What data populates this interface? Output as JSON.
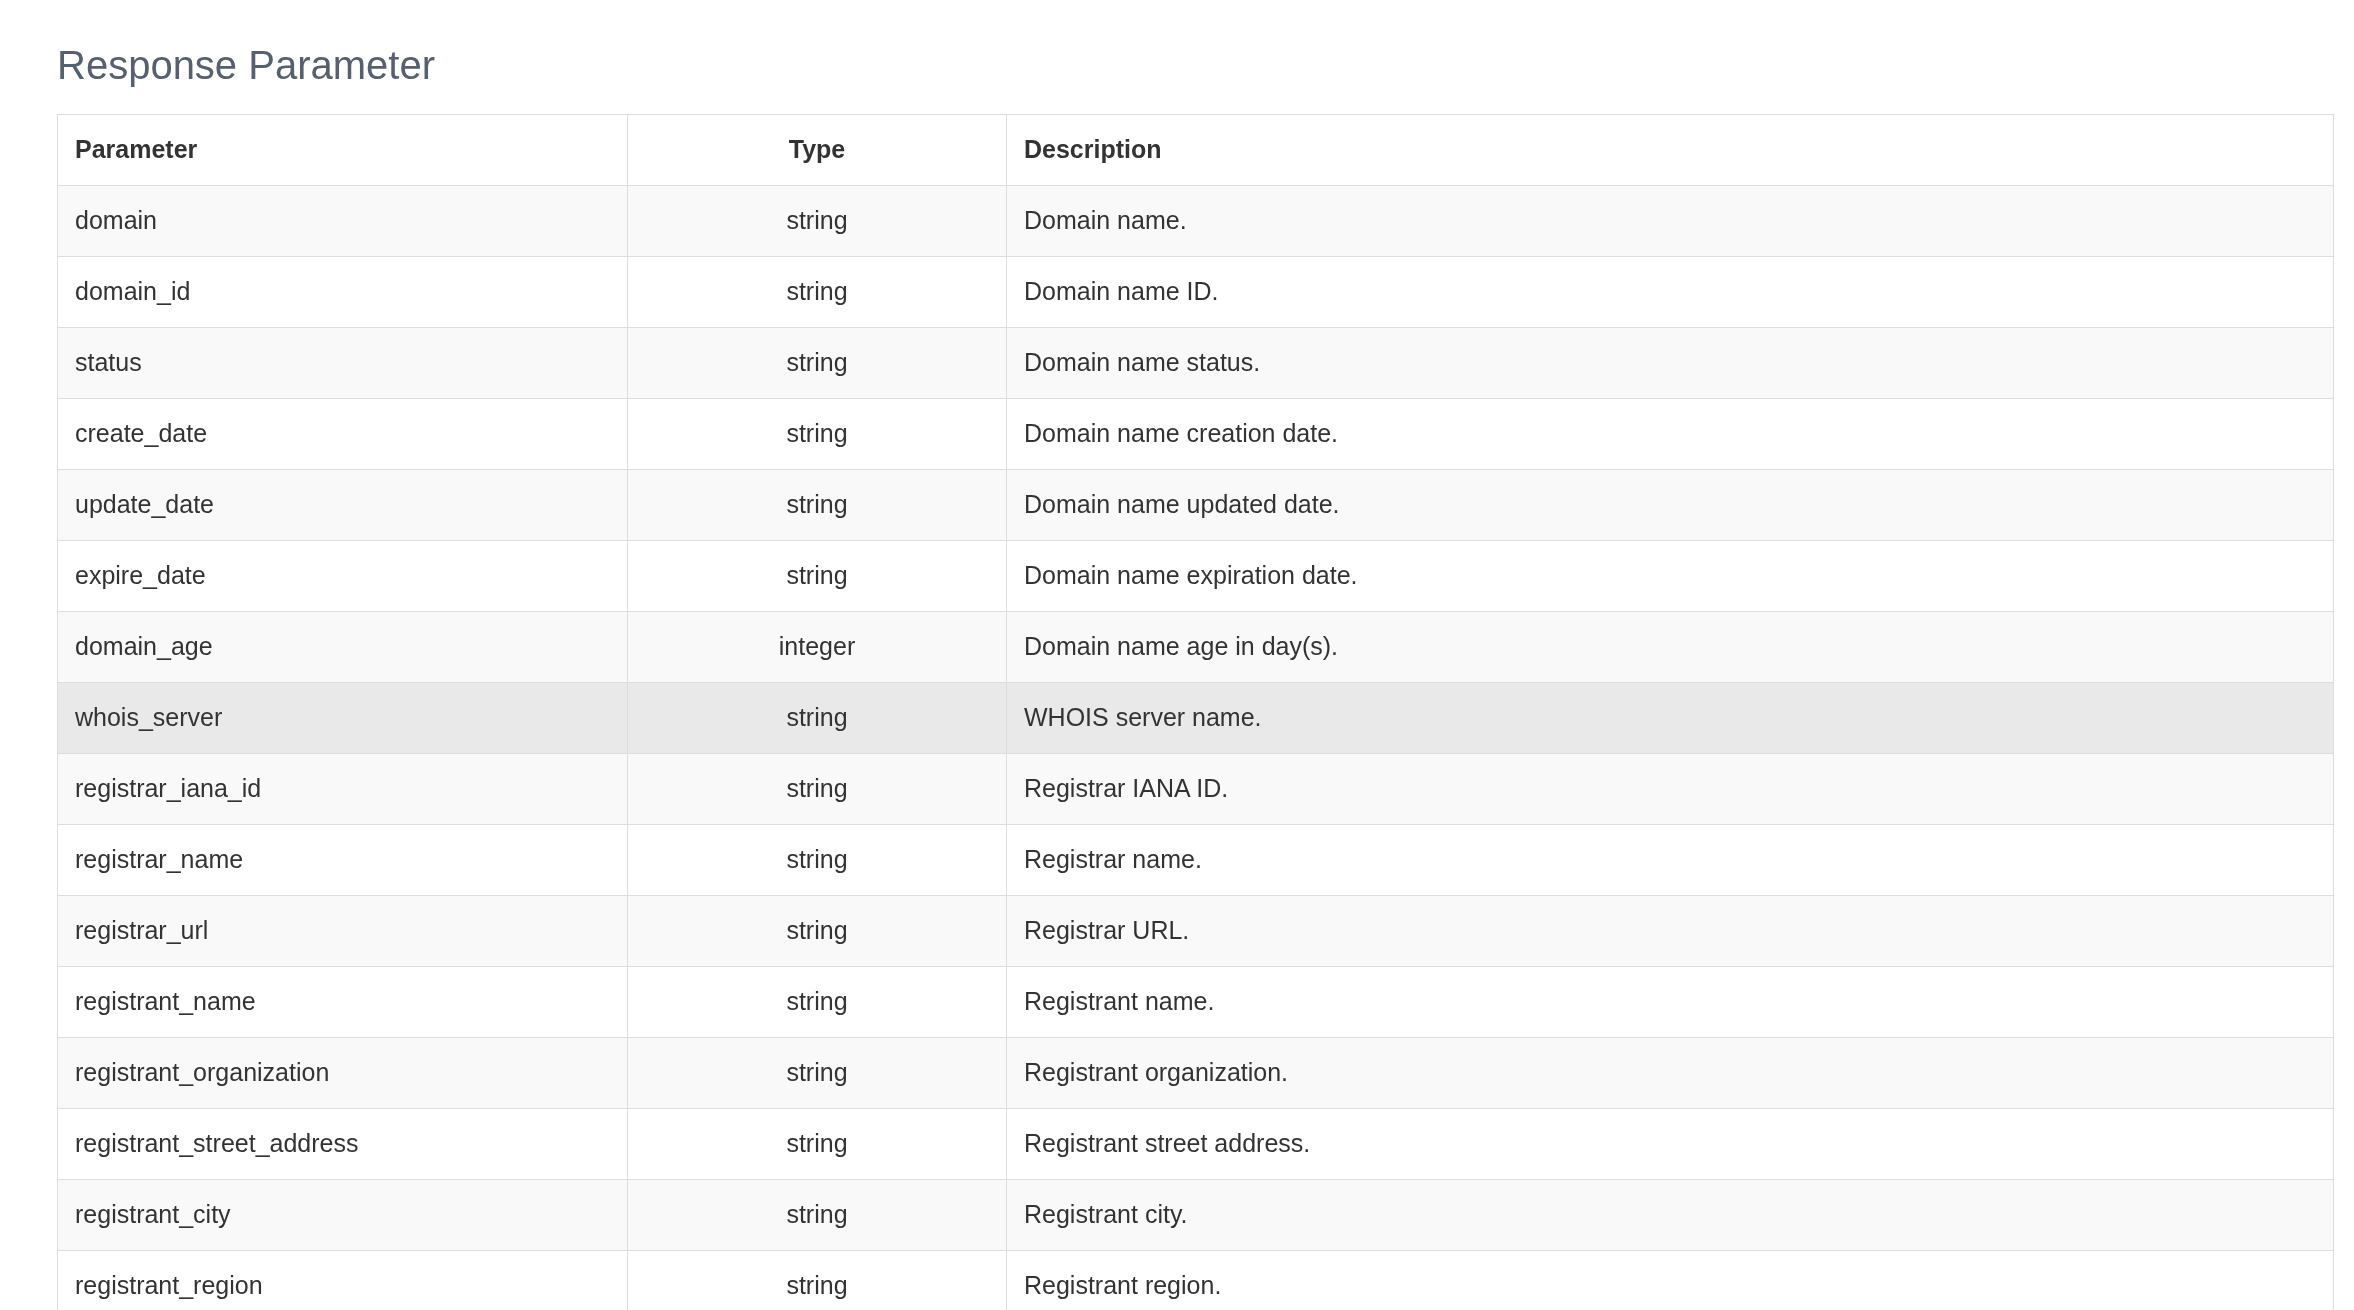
{
  "title": "Response Parameter",
  "table": {
    "columns": [
      "Parameter",
      "Type",
      "Description"
    ],
    "rows": [
      {
        "cells": [
          "domain",
          "string",
          "Domain name."
        ],
        "hovered": false
      },
      {
        "cells": [
          "domain_id",
          "string",
          "Domain name ID."
        ],
        "hovered": false
      },
      {
        "cells": [
          "status",
          "string",
          "Domain name status."
        ],
        "hovered": false
      },
      {
        "cells": [
          "create_date",
          "string",
          "Domain name creation date."
        ],
        "hovered": false
      },
      {
        "cells": [
          "update_date",
          "string",
          "Domain name updated date."
        ],
        "hovered": false
      },
      {
        "cells": [
          "expire_date",
          "string",
          "Domain name expiration date."
        ],
        "hovered": false
      },
      {
        "cells": [
          "domain_age",
          "integer",
          "Domain name age in day(s)."
        ],
        "hovered": false
      },
      {
        "cells": [
          "whois_server",
          "string",
          "WHOIS server name."
        ],
        "hovered": true
      },
      {
        "cells": [
          "registrar_iana_id",
          "string",
          "Registrar IANA ID."
        ],
        "hovered": false
      },
      {
        "cells": [
          "registrar_name",
          "string",
          "Registrar name."
        ],
        "hovered": false
      },
      {
        "cells": [
          "registrar_url",
          "string",
          "Registrar URL."
        ],
        "hovered": false
      },
      {
        "cells": [
          "registrant_name",
          "string",
          "Registrant name."
        ],
        "hovered": false
      },
      {
        "cells": [
          "registrant_organization",
          "string",
          "Registrant organization."
        ],
        "hovered": false
      },
      {
        "cells": [
          "registrant_street_address",
          "string",
          "Registrant street address."
        ],
        "hovered": false
      },
      {
        "cells": [
          "registrant_city",
          "string",
          "Registrant city."
        ],
        "hovered": false
      },
      {
        "cells": [
          "registrant_region",
          "string",
          "Registrant region."
        ],
        "hovered": false
      }
    ]
  }
}
